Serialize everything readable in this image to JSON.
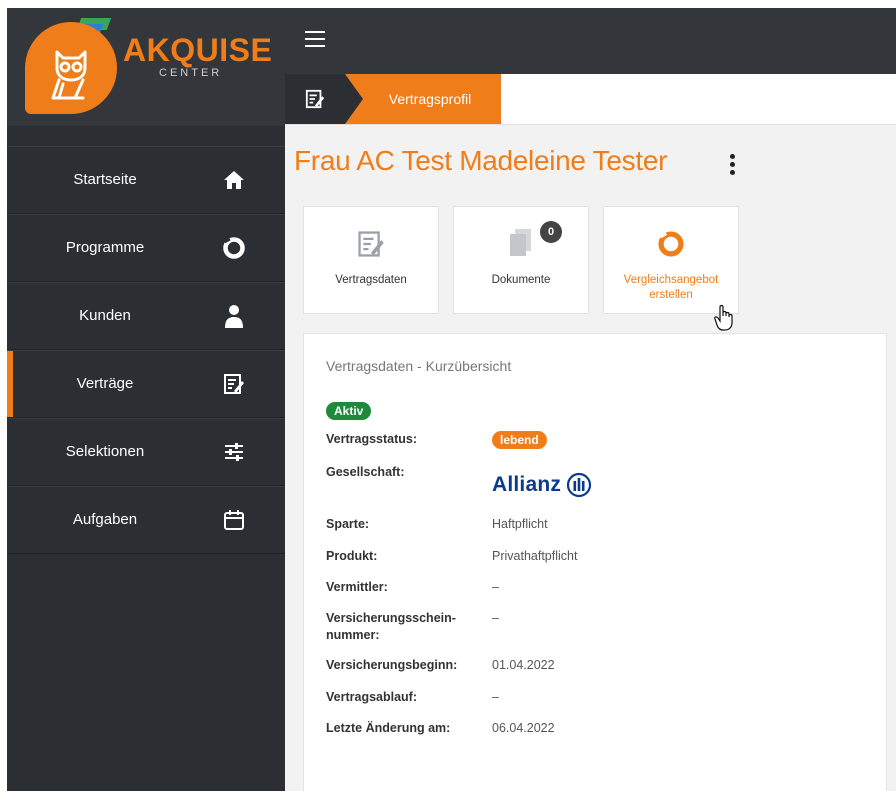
{
  "app": {
    "logo_text": "AKQUISE",
    "logo_sub": "CENTER"
  },
  "colors": {
    "accent": "#ef7d1a",
    "sidebar": "#2b2e33",
    "active_badge": "#1e8a3c",
    "allianz_blue": "#0a3b8f"
  },
  "sidebar": {
    "items": [
      {
        "label": "Startseite",
        "icon": "home-icon",
        "active": false
      },
      {
        "label": "Programme",
        "icon": "programme-ring-icon",
        "active": false
      },
      {
        "label": "Kunden",
        "icon": "person-icon",
        "active": false
      },
      {
        "label": "Verträge",
        "icon": "contract-edit-icon",
        "active": true
      },
      {
        "label": "Selektionen",
        "icon": "sliders-icon",
        "active": false
      },
      {
        "label": "Aufgaben",
        "icon": "calendar-icon",
        "active": false
      }
    ]
  },
  "breadcrumb": {
    "current": "Vertragsprofil"
  },
  "page": {
    "title": "Frau AC Test Madeleine Tester"
  },
  "cards": [
    {
      "label": "Vertragsdaten",
      "icon": "contract-edit-icon"
    },
    {
      "label": "Dokumente",
      "icon": "documents-icon",
      "badge": "0"
    },
    {
      "label": "Vergleichsangebot erstellen",
      "icon": "programme-ring-icon"
    }
  ],
  "panel": {
    "title": "Vertragsdaten - Kurzübersicht",
    "status_badge": "Aktiv",
    "rows": [
      {
        "key": "Vertragsstatus:",
        "value": "lebend"
      },
      {
        "key": "Gesellschaft:",
        "value": "Allianz"
      },
      {
        "key": "Sparte:",
        "value": "Haftpflicht"
      },
      {
        "key": "Produkt:",
        "value": "Privathaftpflicht"
      },
      {
        "key": "Vermittler:",
        "value": "–"
      },
      {
        "key": "Versicherungsschein-nummer:",
        "value": "–"
      },
      {
        "key": "Versicherungsbeginn:",
        "value": "01.04.2022"
      },
      {
        "key": "Vertragsablauf:",
        "value": "–"
      },
      {
        "key": "Letzte Änderung am:",
        "value": "06.04.2022"
      }
    ]
  }
}
